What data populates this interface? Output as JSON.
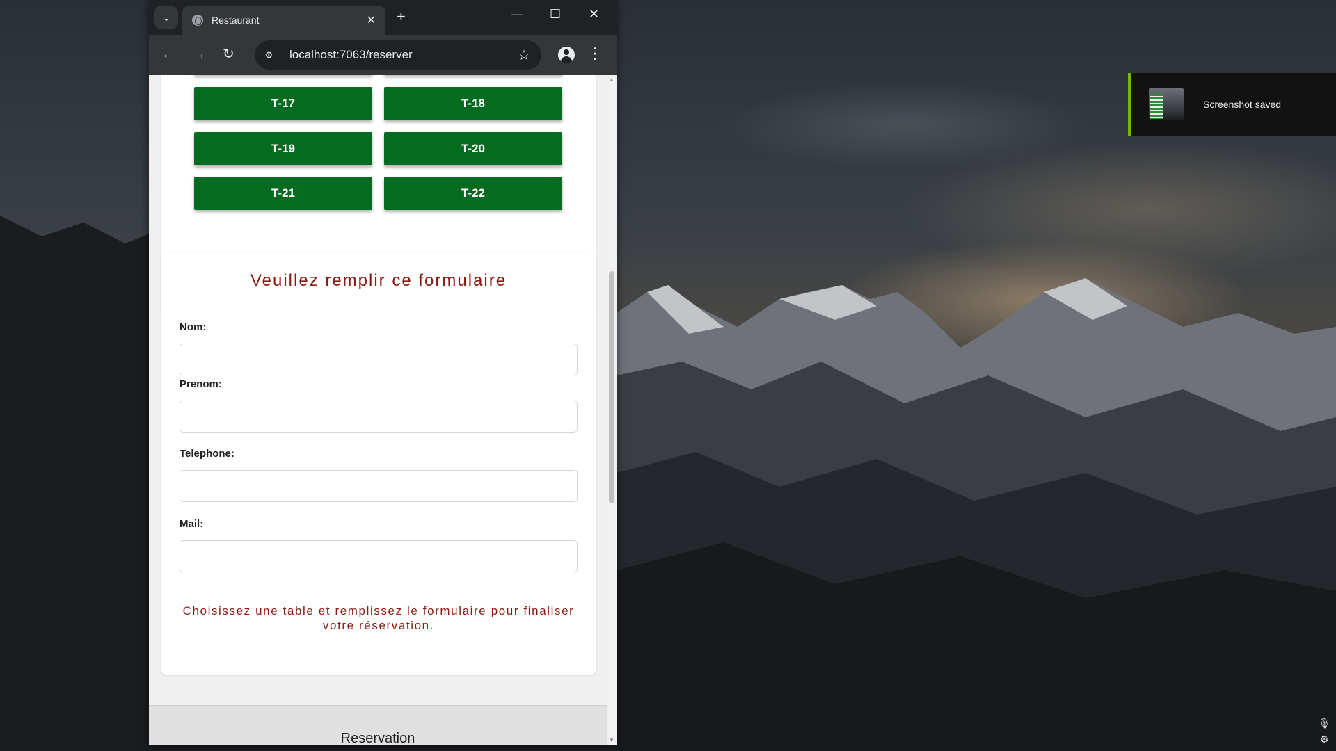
{
  "browser": {
    "tab_title": "Restaurant",
    "url": "localhost:7063/reserver",
    "icons": {
      "tab_search": "chevron-down-icon",
      "favicon": "globe-icon",
      "close_tab": "close-icon",
      "new_tab": "plus-icon",
      "back": "arrow-left-icon",
      "forward": "arrow-right-icon",
      "reload": "reload-icon",
      "site_info": "tune-icon",
      "bookmark": "star-icon",
      "profile": "person-icon",
      "menu": "kebab-menu-icon"
    }
  },
  "tables": {
    "buttons": [
      "T-17",
      "T-18",
      "T-19",
      "T-20",
      "T-21",
      "T-22"
    ],
    "color": "#046b20"
  },
  "form": {
    "title": "Veuillez remplir ce formulaire",
    "fields": [
      {
        "label": "Nom:",
        "value": ""
      },
      {
        "label": "Prenom:",
        "value": ""
      },
      {
        "label": "Telephone:",
        "value": ""
      },
      {
        "label": "Mail:",
        "value": ""
      }
    ],
    "hint": "Choisissez une table et remplissez le formulaire pour finaliser votre réservation.",
    "accent_color": "#8b1a10"
  },
  "footer": {
    "title": "Reservation"
  },
  "notification": {
    "text": "Screenshot saved",
    "accent_color": "#76b900"
  }
}
